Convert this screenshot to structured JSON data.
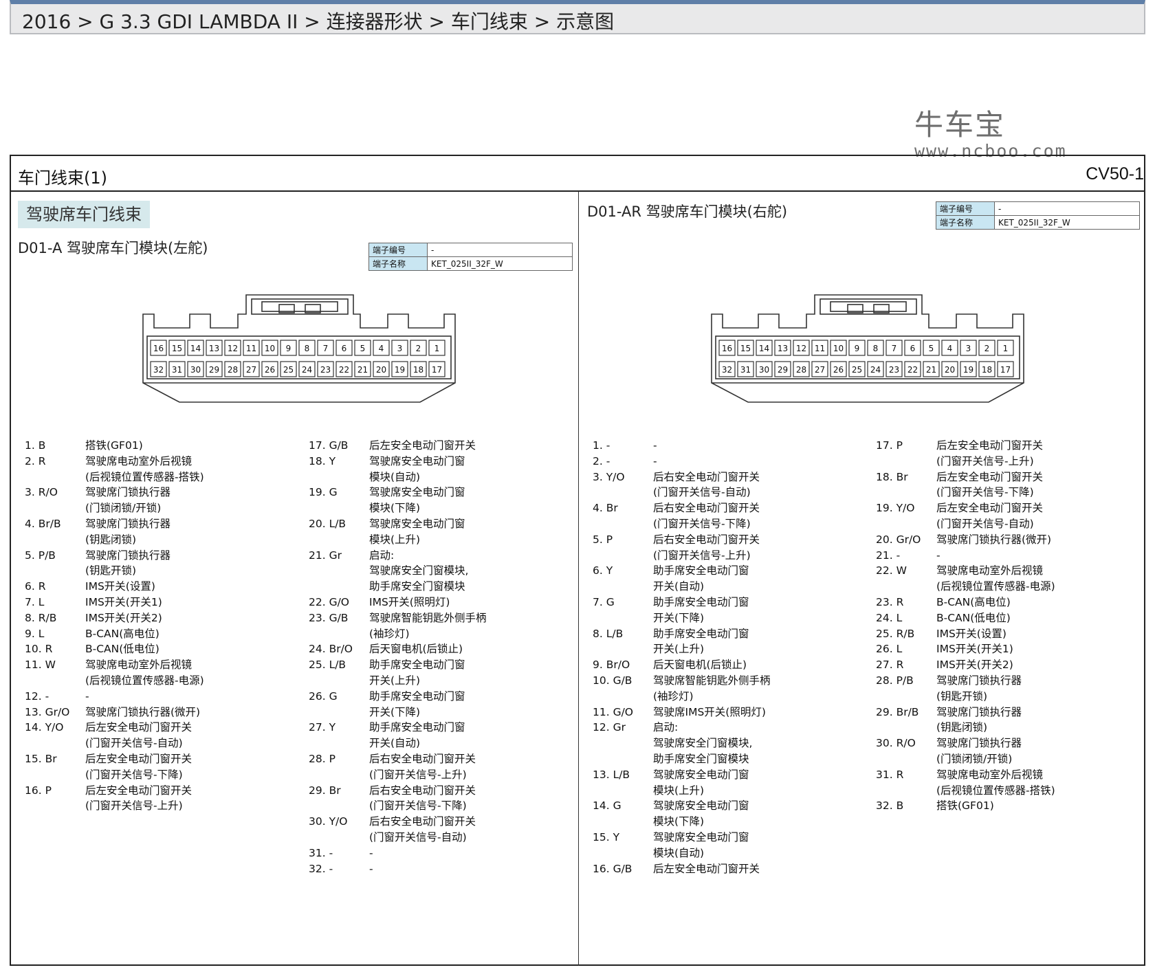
{
  "breadcrumb": "2016 > G 3.3 GDI LAMBDA II > 连接器形状 > 车门线束 > 示意图",
  "watermark": {
    "brand": "牛车宝",
    "url": "www.ncboo.com"
  },
  "page": {
    "title": "车门线束(1)",
    "code": "CV50-1",
    "section_tag": "驾驶席车门线束"
  },
  "left_module": {
    "title": "D01-A   驾驶席车门模块(左舵)",
    "terminal_no_label": "端子编号",
    "terminal_no_value": "-",
    "terminal_name_label": "端子名称",
    "terminal_name_value": "KET_025II_32F_W"
  },
  "right_module": {
    "title": "D01-AR 驾驶席车门模块(右舵)",
    "terminal_no_label": "端子编号",
    "terminal_no_value": "-",
    "terminal_name_label": "端子名称",
    "terminal_name_value": "KET_025II_32F_W"
  },
  "connector": {
    "top_row": [
      "16",
      "15",
      "14",
      "13",
      "12",
      "11",
      "10",
      "9",
      "8",
      "7",
      "6",
      "5",
      "4",
      "3",
      "2",
      "1"
    ],
    "bottom_row": [
      "32",
      "31",
      "30",
      "29",
      "28",
      "27",
      "26",
      "25",
      "24",
      "23",
      "22",
      "21",
      "20",
      "19",
      "18",
      "17"
    ]
  },
  "left_pins": [
    [
      {
        "id": "1. B",
        "desc": "搭铁(GF01)"
      },
      {
        "id": "2. R",
        "desc": "驾驶席电动室外后视镜\n(后视镜位置传感器-搭铁)"
      },
      {
        "id": "3. R/O",
        "desc": "驾驶席门锁执行器\n(门锁闭锁/开锁)"
      },
      {
        "id": "4. Br/B",
        "desc": "驾驶席门锁执行器\n(钥匙闭锁)"
      },
      {
        "id": "5. P/B",
        "desc": "驾驶席门锁执行器\n(钥匙开锁)"
      },
      {
        "id": "6. R",
        "desc": "IMS开关(设置)"
      },
      {
        "id": "7. L",
        "desc": "IMS开关(开关1)"
      },
      {
        "id": "8. R/B",
        "desc": "IMS开关(开关2)"
      },
      {
        "id": "9. L",
        "desc": "B-CAN(高电位)"
      },
      {
        "id": "10. R",
        "desc": "B-CAN(低电位)"
      },
      {
        "id": "11. W",
        "desc": "驾驶席电动室外后视镜\n(后视镜位置传感器-电源)"
      },
      {
        "id": "12. -",
        "desc": "-"
      },
      {
        "id": "13. Gr/O",
        "desc": "驾驶席门锁执行器(微开)"
      },
      {
        "id": "14. Y/O",
        "desc": "后左安全电动门窗开关\n(门窗开关信号-自动)"
      },
      {
        "id": "15. Br",
        "desc": "后左安全电动门窗开关\n(门窗开关信号-下降)"
      },
      {
        "id": "16. P",
        "desc": "后左安全电动门窗开关\n(门窗开关信号-上升)"
      }
    ],
    [
      {
        "id": "17. G/B",
        "desc": "后左安全电动门窗开关"
      },
      {
        "id": "18. Y",
        "desc": "驾驶席安全电动门窗\n模块(自动)"
      },
      {
        "id": "19. G",
        "desc": "驾驶席安全电动门窗\n模块(下降)"
      },
      {
        "id": "20. L/B",
        "desc": "驾驶席安全电动门窗\n模块(上升)"
      },
      {
        "id": "21. Gr",
        "desc": "启动:\n驾驶席安全门窗模块,\n助手席安全门窗模块"
      },
      {
        "id": "22. G/O",
        "desc": "IMS开关(照明灯)"
      },
      {
        "id": "23. G/B",
        "desc": "驾驶席智能钥匙外侧手柄\n(袖珍灯)"
      },
      {
        "id": "24. Br/O",
        "desc": "后天窗电机(后锁止)"
      },
      {
        "id": "25. L/B",
        "desc": "助手席安全电动门窗\n开关(上升)"
      },
      {
        "id": "26. G",
        "desc": "助手席安全电动门窗\n开关(下降)"
      },
      {
        "id": "27. Y",
        "desc": "助手席安全电动门窗\n开关(自动)"
      },
      {
        "id": "28. P",
        "desc": "后右安全电动门窗开关\n(门窗开关信号-上升)"
      },
      {
        "id": "29. Br",
        "desc": "后右安全电动门窗开关\n(门窗开关信号-下降)"
      },
      {
        "id": "30. Y/O",
        "desc": "后右安全电动门窗开关\n(门窗开关信号-自动)"
      },
      {
        "id": "31. -",
        "desc": "-"
      },
      {
        "id": "32. -",
        "desc": "-"
      }
    ]
  ],
  "right_pins": [
    [
      {
        "id": "1. -",
        "desc": "-"
      },
      {
        "id": "2. -",
        "desc": "-"
      },
      {
        "id": "3. Y/O",
        "desc": "后右安全电动门窗开关\n(门窗开关信号-自动)"
      },
      {
        "id": "4. Br",
        "desc": "后右安全电动门窗开关\n(门窗开关信号-下降)"
      },
      {
        "id": "5. P",
        "desc": "后右安全电动门窗开关\n(门窗开关信号-上升)"
      },
      {
        "id": "6. Y",
        "desc": "助手席安全电动门窗\n开关(自动)"
      },
      {
        "id": "7. G",
        "desc": "助手席安全电动门窗\n开关(下降)"
      },
      {
        "id": "8. L/B",
        "desc": "助手席安全电动门窗\n开关(上升)"
      },
      {
        "id": "9. Br/O",
        "desc": "后天窗电机(后锁止)"
      },
      {
        "id": "10. G/B",
        "desc": "驾驶席智能钥匙外侧手柄\n(袖珍灯)"
      },
      {
        "id": "11. G/O",
        "desc": "驾驶席IMS开关(照明灯)"
      },
      {
        "id": "12. Gr",
        "desc": "启动:\n驾驶席安全门窗模块,\n助手席安全门窗模块"
      },
      {
        "id": "13. L/B",
        "desc": "驾驶席安全电动门窗\n模块(上升)"
      },
      {
        "id": "14. G",
        "desc": "驾驶席安全电动门窗\n模块(下降)"
      },
      {
        "id": "15. Y",
        "desc": "驾驶席安全电动门窗\n模块(自动)"
      },
      {
        "id": "16. G/B",
        "desc": "后左安全电动门窗开关"
      }
    ],
    [
      {
        "id": "17. P",
        "desc": "后左安全电动门窗开关\n(门窗开关信号-上升)"
      },
      {
        "id": "18. Br",
        "desc": "后左安全电动门窗开关\n(门窗开关信号-下降)"
      },
      {
        "id": "19. Y/O",
        "desc": "后左安全电动门窗开关\n(门窗开关信号-自动)"
      },
      {
        "id": "20. Gr/O",
        "desc": "驾驶席门锁执行器(微开)"
      },
      {
        "id": "21. -",
        "desc": "-"
      },
      {
        "id": "22. W",
        "desc": "驾驶席电动室外后视镜\n(后视镜位置传感器-电源)"
      },
      {
        "id": "23. R",
        "desc": "B-CAN(高电位)"
      },
      {
        "id": "24. L",
        "desc": "B-CAN(低电位)"
      },
      {
        "id": "25. R/B",
        "desc": "IMS开关(设置)"
      },
      {
        "id": "26. L",
        "desc": "IMS开关(开关1)"
      },
      {
        "id": "27. R",
        "desc": "IMS开关(开关2)"
      },
      {
        "id": "28. P/B",
        "desc": "驾驶席门锁执行器\n(钥匙开锁)"
      },
      {
        "id": "29. Br/B",
        "desc": "驾驶席门锁执行器\n(钥匙闭锁)"
      },
      {
        "id": "30. R/O",
        "desc": "驾驶席门锁执行器\n(门锁闭锁/开锁)"
      },
      {
        "id": "31. R",
        "desc": "驾驶席电动室外后视镜\n(后视镜位置传感器-搭铁)"
      },
      {
        "id": "32. B",
        "desc": "搭铁(GF01)"
      }
    ]
  ]
}
